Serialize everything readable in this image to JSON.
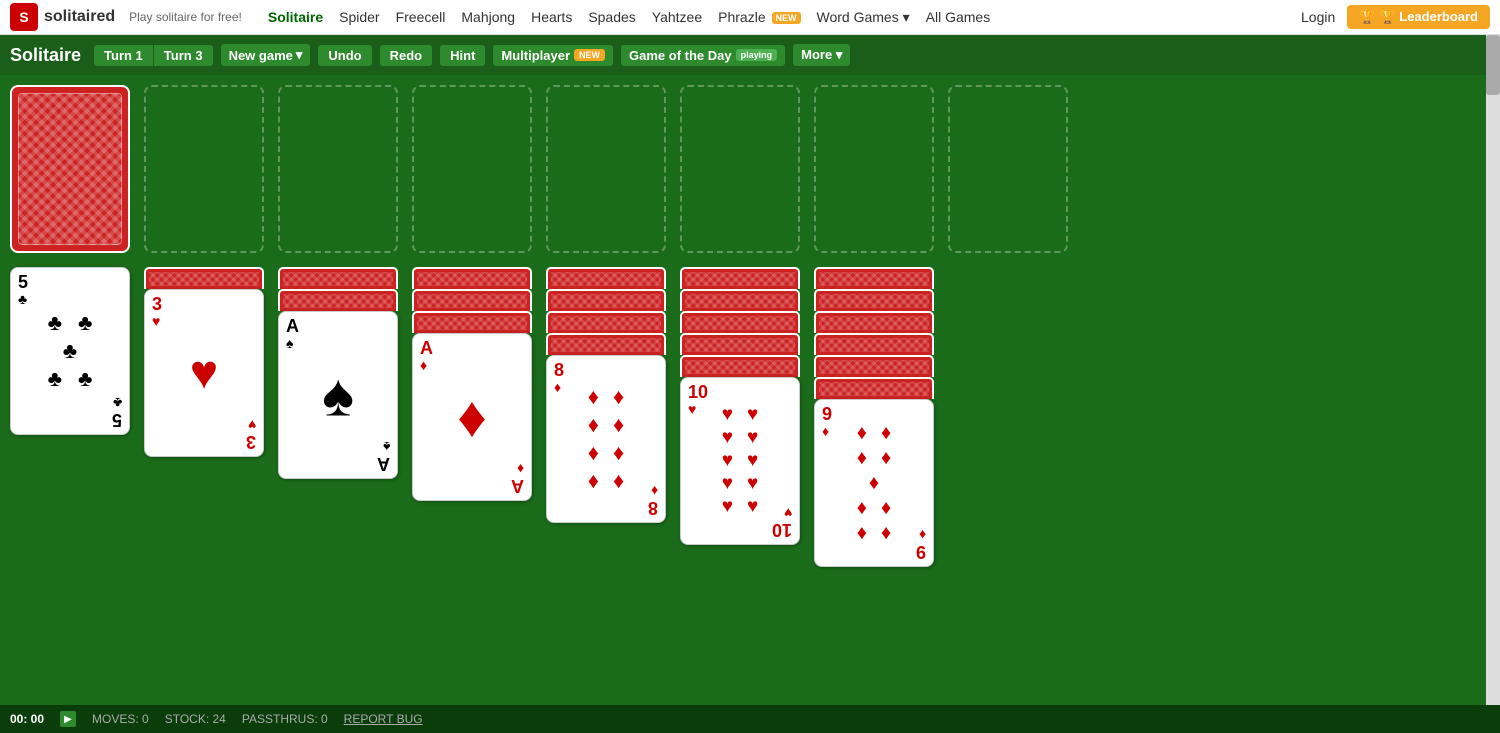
{
  "topnav": {
    "logo": "solitaired",
    "tagline": "Play solitaire for free!",
    "links": [
      {
        "label": "Solitaire",
        "active": true
      },
      {
        "label": "Spider"
      },
      {
        "label": "Freecell"
      },
      {
        "label": "Mahjong"
      },
      {
        "label": "Hearts"
      },
      {
        "label": "Spades"
      },
      {
        "label": "Yahtzee"
      },
      {
        "label": "Phrazle",
        "badge": "NEW"
      },
      {
        "label": "Word Games",
        "dropdown": true
      },
      {
        "label": "All Games"
      }
    ],
    "login": "Login",
    "leaderboard": "🏆 Leaderboard"
  },
  "toolbar": {
    "title": "Solitaire",
    "turn1": "Turn 1",
    "turn3": "Turn 3",
    "newgame": "New game",
    "undo": "Undo",
    "redo": "Redo",
    "hint": "Hint",
    "multiplayer": "Multiplayer",
    "multiplayer_badge": "NEW",
    "gotd": "Game of the Day",
    "gotd_badge": "playing",
    "more": "More"
  },
  "statusbar": {
    "timer": "00: 00",
    "moves_label": "MOVES: 0",
    "stock_label": "STOCK: 24",
    "passthrus_label": "PASSTHRUS: 0",
    "report": "REPORT BUG"
  },
  "colors": {
    "green_dark": "#1a6b1a",
    "green_nav": "#1a5e1a",
    "red": "#cc0000"
  }
}
